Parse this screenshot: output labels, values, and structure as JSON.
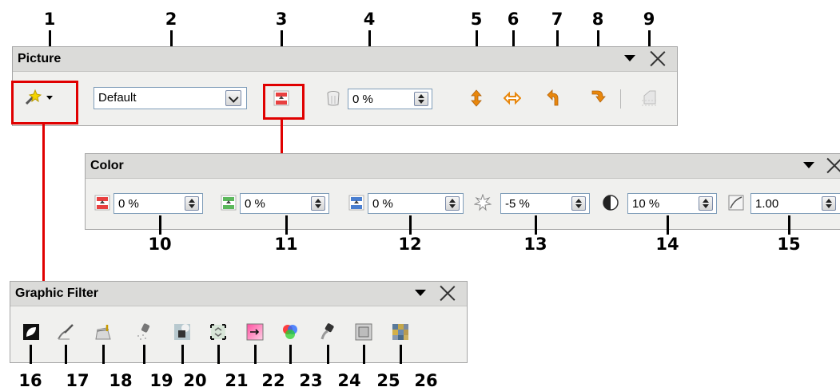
{
  "callouts": {
    "n1": "1",
    "n2": "2",
    "n3": "3",
    "n4": "4",
    "n5": "5",
    "n6": "6",
    "n7": "7",
    "n8": "8",
    "n9": "9",
    "n10": "10",
    "n11": "11",
    "n12": "12",
    "n13": "13",
    "n14": "14",
    "n15": "15",
    "n16": "16",
    "n17": "17",
    "n18": "18",
    "n19": "19",
    "n20": "20",
    "n21": "21",
    "n22": "22",
    "n23": "23",
    "n24": "24",
    "n25": "25",
    "n26": "26"
  },
  "picture": {
    "title": "Picture",
    "graphics_mode": "Default",
    "transparency": "0 %",
    "icons": [
      "filter-icon",
      "color-icon",
      "transparency-icon",
      "flip-vertical-icon",
      "flip-horizontal-icon",
      "rotate-left-icon",
      "rotate-right-icon",
      "crop-icon"
    ]
  },
  "color": {
    "title": "Color",
    "red": "0 %",
    "green": "0 %",
    "blue": "0 %",
    "brightness": "-5 %",
    "contrast": "10 %",
    "gamma": "1.00"
  },
  "graphic_filter": {
    "title": "Graphic Filter",
    "icons": [
      "invert-icon",
      "smooth-icon",
      "sharpen-icon",
      "remove-noise-icon",
      "solarization-icon",
      "aging-icon",
      "posterize-icon",
      "pop-art-icon",
      "charcoal-icon",
      "relief-icon",
      "mosaic-icon"
    ]
  },
  "colors": {
    "callout_red": "#e00000",
    "icon_orange": "#e8870c"
  }
}
